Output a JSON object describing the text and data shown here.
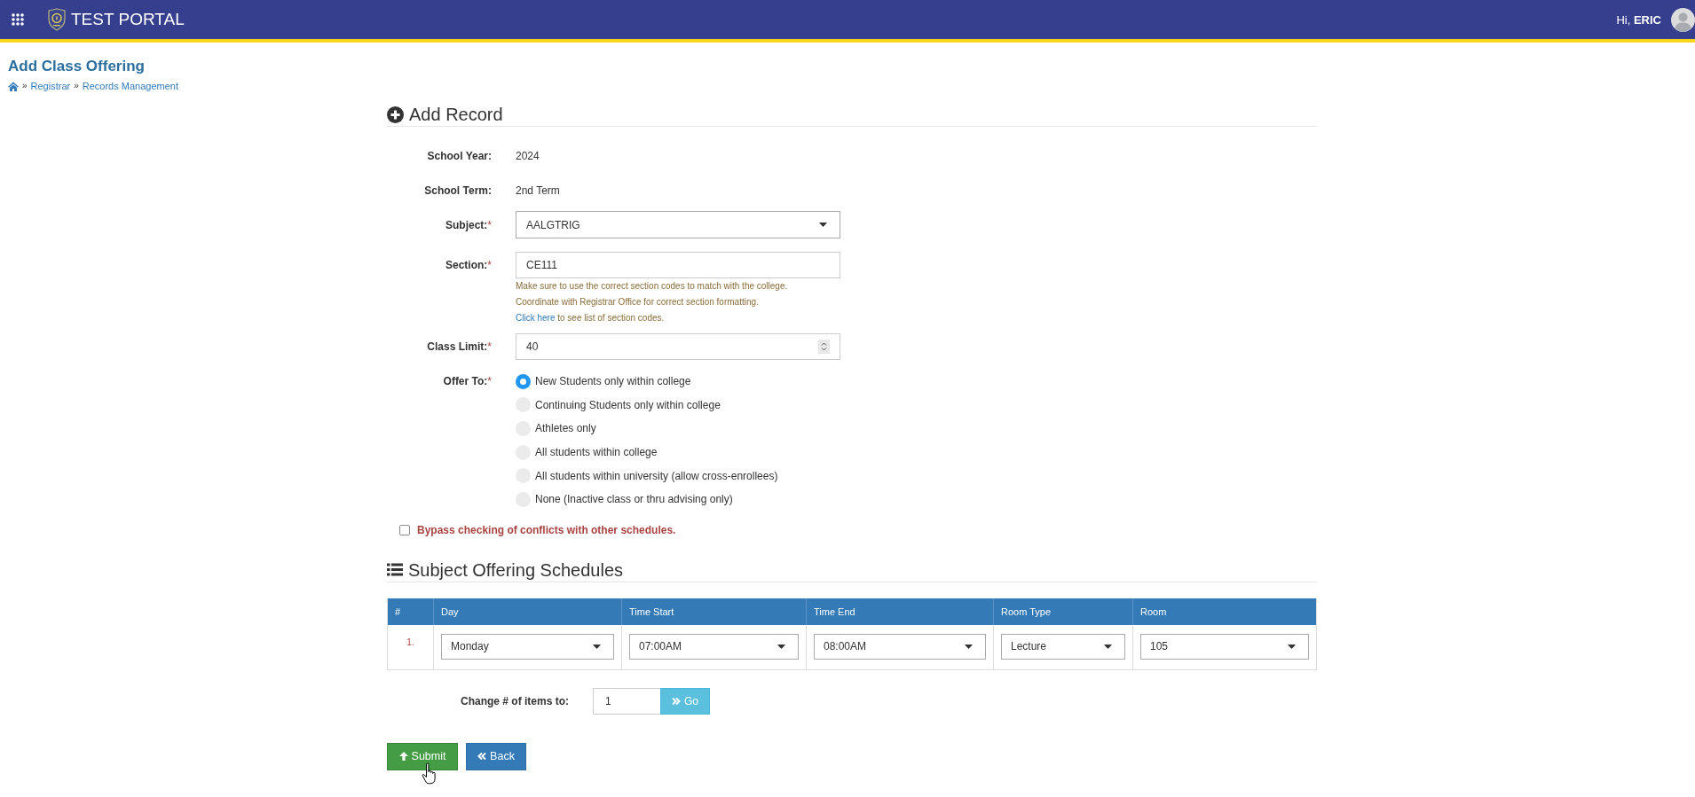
{
  "header": {
    "app_name": "TEST PORTAL",
    "greeting": "Hi, **ERIC**"
  },
  "page": {
    "title": "Add Class Offering",
    "breadcrumbs": [
      {
        "separator": "»",
        "label": "Registrar"
      },
      {
        "separator": "»",
        "label": "Records Management"
      }
    ]
  },
  "record": {
    "title": "Add Record",
    "fields": [
      {
        "kind": "static",
        "label": "School Year:",
        "value": "2024"
      },
      {
        "kind": "static",
        "label": "School Term:",
        "value": "2nd Term"
      },
      {
        "kind": "select",
        "label": "Subject:",
        "asterisk": "*",
        "value": "AALGTRIG"
      },
      {
        "kind": "text",
        "label": "Section:",
        "asterisk": "*",
        "value": "CE111",
        "help": [
          "Make sure to use the correct section codes to match with the college.",
          "Coordinate with Registrar Office for correct section formatting."
        ],
        "help_link": "Click here",
        "help_rest": "to see list of section codes."
      },
      {
        "kind": "number",
        "label": "Class Limit:",
        "asterisk": "*",
        "value": "40"
      },
      {
        "kind": "radio",
        "label": "Offer To:",
        "asterisk": "*",
        "options": [
          {
            "label": "New Students only within college",
            "selected": true
          },
          {
            "label": "Continuing Students only within college",
            "selected": false
          },
          {
            "label": "Athletes only",
            "selected": false
          },
          {
            "label": "All students within college",
            "selected": false
          },
          {
            "label": "All students within university (allow cross-enrollees)",
            "selected": false
          },
          {
            "label": "None (Inactive class or thru advising only)",
            "selected": false
          }
        ]
      }
    ],
    "bypass": {
      "label": "Bypass checking of conflicts with other schedules.",
      "checked": false
    }
  },
  "schedules": {
    "title": "Subject Offering Schedules",
    "columns": [
      "#",
      "Day",
      "Time Start",
      "Time End",
      "Room Type",
      "Room"
    ],
    "rows": [
      {
        "cells": [
          "1.",
          "Monday",
          "07:00AM",
          "08:00AM",
          "Lecture",
          "105"
        ]
      }
    ],
    "item_count": {
      "label": "Change # of items to:",
      "value": "1",
      "button": "Go"
    }
  },
  "buttons": [
    {
      "kind": "submit",
      "label": "Submit"
    },
    {
      "kind": "back",
      "label": "Back"
    }
  ]
}
